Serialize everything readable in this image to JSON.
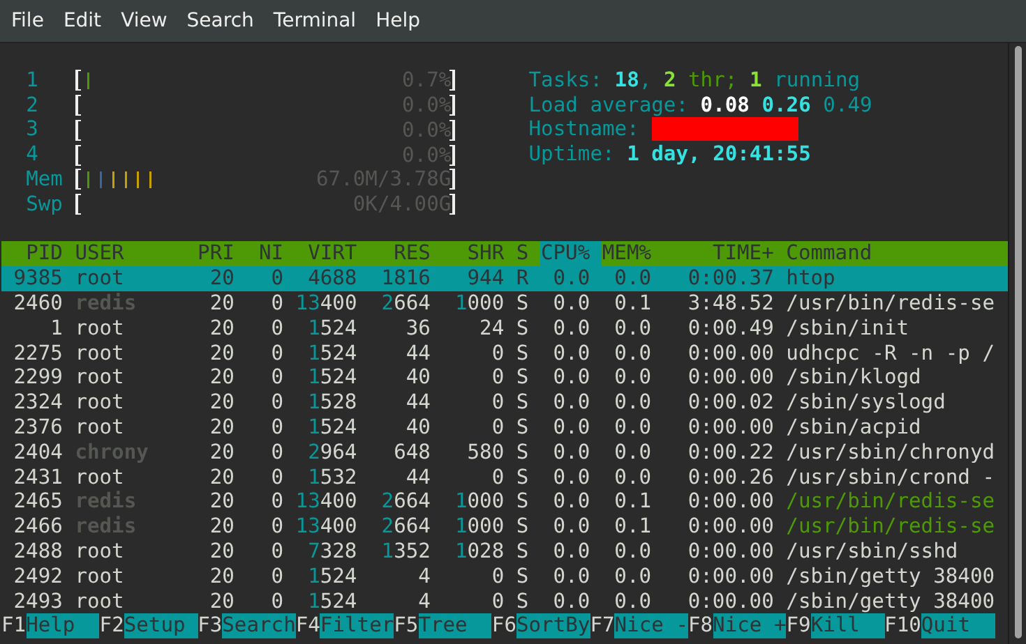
{
  "menu": [
    "File",
    "Edit",
    "View",
    "Search",
    "Terminal",
    "Help"
  ],
  "meters": [
    {
      "label": "1",
      "segments": [
        {
          "color": "#4e9a06",
          "level": 0.032
        }
      ],
      "value": "0.7%"
    },
    {
      "label": "2",
      "value": "0.0%"
    },
    {
      "label": "3",
      "value": "0.0%"
    },
    {
      "label": "4",
      "value": "0.0%"
    },
    {
      "label": "Mem",
      "segments": [
        {
          "color": "#4e9a06",
          "level": 0.032
        },
        {
          "color": "#3465a4",
          "level": 0.032
        },
        {
          "color": "#c4a000",
          "level": 0.129
        }
      ],
      "value": "67.0M/3.78G"
    },
    {
      "label": "Swp",
      "value": "0K/4.00G"
    }
  ],
  "summary": [
    {
      "redacted": false,
      "parts": [
        {
          "text": "Tasks: ",
          "kind": "label"
        },
        {
          "text": "18",
          "kind": "value"
        },
        {
          "text": ", ",
          "kind": "label"
        },
        {
          "text": "2",
          "kind": "threads"
        },
        {
          "text": " thr; ",
          "kind": "thread-label"
        },
        {
          "text": "1",
          "kind": "running"
        },
        {
          "text": " running",
          "kind": "label"
        }
      ]
    },
    {
      "redacted": false,
      "parts": [
        {
          "text": "Load average: ",
          "kind": "label"
        },
        {
          "text": "0.08",
          "kind": "load1"
        },
        {
          "text": " 0.26",
          "kind": "value"
        },
        {
          "text": " 0.49",
          "kind": "label"
        }
      ]
    },
    {
      "redacted": true,
      "parts": [
        {
          "text": "Hostname:",
          "kind": "label"
        }
      ]
    },
    {
      "redacted": false,
      "parts": [
        {
          "text": "Uptime: ",
          "kind": "label"
        },
        {
          "text": "1 day, 20:41:55",
          "kind": "value"
        }
      ]
    }
  ],
  "columns": [
    {
      "label": "PID",
      "sorted": false
    },
    {
      "label": "USER",
      "sorted": false
    },
    {
      "label": "PRI",
      "sorted": false
    },
    {
      "label": "NI",
      "sorted": false
    },
    {
      "label": "VIRT",
      "sorted": false
    },
    {
      "label": "RES",
      "sorted": false
    },
    {
      "label": "SHR",
      "sorted": false
    },
    {
      "label": "S",
      "sorted": false
    },
    {
      "label": "CPU%",
      "sorted": true
    },
    {
      "label": "MEM%",
      "sorted": false
    },
    {
      "label": "TIME+",
      "sorted": false
    },
    {
      "label": "Command",
      "sorted": false
    }
  ],
  "processes": [
    {
      "selected": true,
      "user_dimmed": false,
      "thread": false,
      "cells": [
        "9385",
        "root",
        "20",
        "0",
        "4688",
        "1816",
        "944",
        "R",
        "0.0",
        "0.0",
        "0:00.37",
        "htop"
      ]
    },
    {
      "selected": false,
      "user_dimmed": true,
      "thread": false,
      "cells": [
        "2460",
        "redis",
        "20",
        "0",
        "13400",
        "2664",
        "1000",
        "S",
        "0.0",
        "0.1",
        "3:48.52",
        "/usr/bin/redis-se"
      ]
    },
    {
      "selected": false,
      "user_dimmed": false,
      "thread": false,
      "cells": [
        "1",
        "root",
        "20",
        "0",
        "1524",
        "36",
        "24",
        "S",
        "0.0",
        "0.0",
        "0:00.49",
        "/sbin/init"
      ]
    },
    {
      "selected": false,
      "user_dimmed": false,
      "thread": false,
      "cells": [
        "2275",
        "root",
        "20",
        "0",
        "1524",
        "44",
        "0",
        "S",
        "0.0",
        "0.0",
        "0:00.00",
        "udhcpc -R -n -p /"
      ]
    },
    {
      "selected": false,
      "user_dimmed": false,
      "thread": false,
      "cells": [
        "2299",
        "root",
        "20",
        "0",
        "1524",
        "40",
        "0",
        "S",
        "0.0",
        "0.0",
        "0:00.00",
        "/sbin/klogd"
      ]
    },
    {
      "selected": false,
      "user_dimmed": false,
      "thread": false,
      "cells": [
        "2324",
        "root",
        "20",
        "0",
        "1528",
        "44",
        "0",
        "S",
        "0.0",
        "0.0",
        "0:00.02",
        "/sbin/syslogd"
      ]
    },
    {
      "selected": false,
      "user_dimmed": false,
      "thread": false,
      "cells": [
        "2376",
        "root",
        "20",
        "0",
        "1524",
        "40",
        "0",
        "S",
        "0.0",
        "0.0",
        "0:00.00",
        "/sbin/acpid"
      ]
    },
    {
      "selected": false,
      "user_dimmed": true,
      "thread": false,
      "cells": [
        "2404",
        "chrony",
        "20",
        "0",
        "2964",
        "648",
        "580",
        "S",
        "0.0",
        "0.0",
        "0:00.22",
        "/usr/sbin/chronyd"
      ]
    },
    {
      "selected": false,
      "user_dimmed": false,
      "thread": false,
      "cells": [
        "2431",
        "root",
        "20",
        "0",
        "1532",
        "44",
        "0",
        "S",
        "0.0",
        "0.0",
        "0:00.26",
        "/usr/sbin/crond -"
      ]
    },
    {
      "selected": false,
      "user_dimmed": true,
      "thread": true,
      "cells": [
        "2465",
        "redis",
        "20",
        "0",
        "13400",
        "2664",
        "1000",
        "S",
        "0.0",
        "0.1",
        "0:00.00",
        "/usr/bin/redis-se"
      ]
    },
    {
      "selected": false,
      "user_dimmed": true,
      "thread": true,
      "cells": [
        "2466",
        "redis",
        "20",
        "0",
        "13400",
        "2664",
        "1000",
        "S",
        "0.0",
        "0.1",
        "0:00.00",
        "/usr/bin/redis-se"
      ]
    },
    {
      "selected": false,
      "user_dimmed": false,
      "thread": false,
      "cells": [
        "2488",
        "root",
        "20",
        "0",
        "7328",
        "1352",
        "1028",
        "S",
        "0.0",
        "0.0",
        "0:00.00",
        "/usr/sbin/sshd"
      ]
    },
    {
      "selected": false,
      "user_dimmed": false,
      "thread": false,
      "cells": [
        "2492",
        "root",
        "20",
        "0",
        "1524",
        "4",
        "0",
        "S",
        "0.0",
        "0.0",
        "0:00.00",
        "/sbin/getty 38400"
      ]
    },
    {
      "selected": false,
      "user_dimmed": false,
      "thread": false,
      "cells": [
        "2493",
        "root",
        "20",
        "0",
        "1524",
        "4",
        "0",
        "S",
        "0.0",
        "0.0",
        "0:00.00",
        "/sbin/getty 38400"
      ]
    }
  ],
  "function_keys": [
    {
      "key": "F1",
      "label": "Help"
    },
    {
      "key": "F2",
      "label": "Setup"
    },
    {
      "key": "F3",
      "label": "Search"
    },
    {
      "key": "F4",
      "label": "Filter"
    },
    {
      "key": "F5",
      "label": "Tree"
    },
    {
      "key": "F6",
      "label": "SortBy"
    },
    {
      "key": "F7",
      "label": "Nice -"
    },
    {
      "key": "F8",
      "label": "Nice +"
    },
    {
      "key": "F9",
      "label": "Kill"
    },
    {
      "key": "F10",
      "label": "Quit"
    }
  ]
}
